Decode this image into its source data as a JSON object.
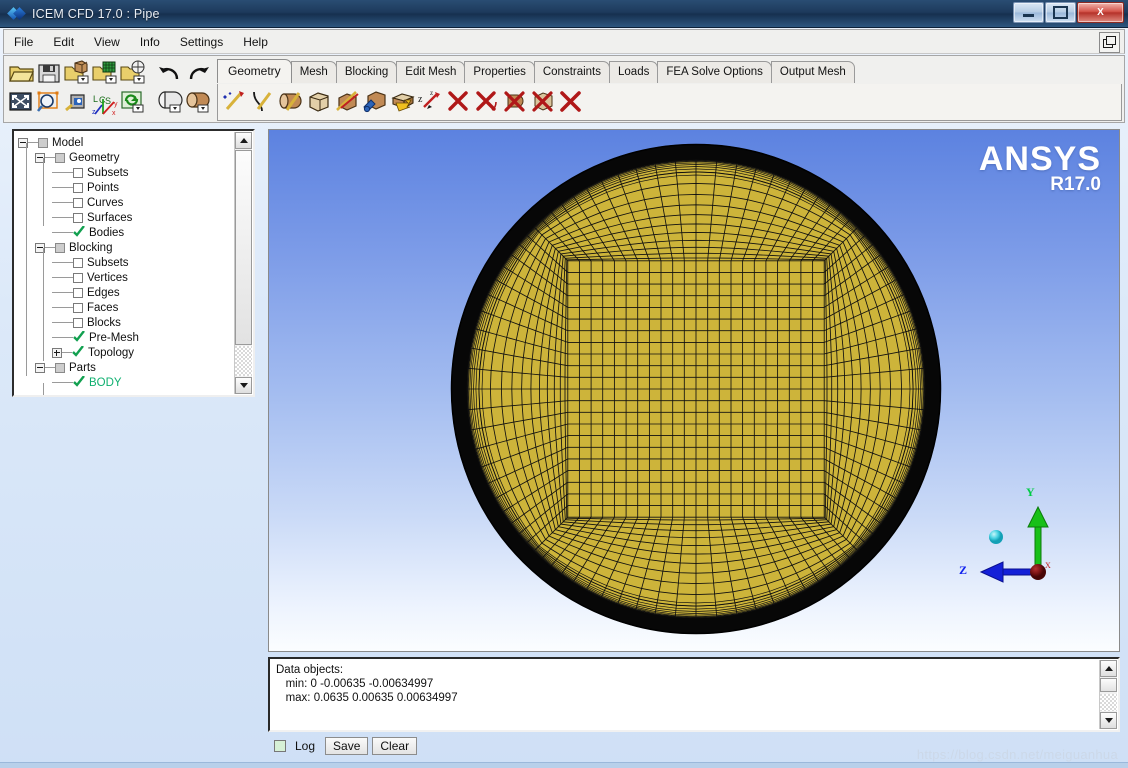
{
  "window": {
    "title": "ICEM CFD 17.0 : Pipe",
    "app_icon": "ansys-diamond-icon",
    "minimize_label": "",
    "restore_label": "",
    "close_label": "X"
  },
  "menubar": {
    "items": [
      "File",
      "Edit",
      "View",
      "Info",
      "Settings",
      "Help"
    ],
    "cascade_icon": "restore-window-icon"
  },
  "toolbar": {
    "main_icons_row1": [
      {
        "name": "open-file-icon",
        "glyph": "folder"
      },
      {
        "name": "save-file-icon",
        "glyph": "floppy"
      },
      {
        "name": "open-geometry-icon",
        "glyph": "folder-box"
      },
      {
        "name": "open-mesh-icon",
        "glyph": "folder-mesh"
      },
      {
        "name": "open-blocking-icon",
        "glyph": "folder-block"
      },
      {
        "name": "undo-icon",
        "glyph": "undo"
      },
      {
        "name": "redo-icon",
        "glyph": "redo"
      }
    ],
    "main_icons_row2": [
      {
        "name": "fit-window-icon",
        "glyph": "fit"
      },
      {
        "name": "zoom-box-icon",
        "glyph": "magnifier"
      },
      {
        "name": "measure-icon",
        "glyph": "measure"
      },
      {
        "name": "local-coord-system-icon",
        "glyph": "lcs"
      },
      {
        "name": "refresh-icon",
        "glyph": "refresh"
      },
      {
        "name": "view-sections-icon",
        "glyph": "cut-cylinder"
      },
      {
        "name": "view-solid-icon",
        "glyph": "solid-cylinder"
      }
    ],
    "function_icons": [
      {
        "name": "create-point-icon"
      },
      {
        "name": "create-curve-icon"
      },
      {
        "name": "create-surface-icon"
      },
      {
        "name": "create-body-icon"
      },
      {
        "name": "repair-geometry-icon"
      },
      {
        "name": "transform-geometry-icon"
      },
      {
        "name": "restore-dormant-icon"
      },
      {
        "name": "create-midsurface-icon"
      },
      {
        "name": "delete-point-icon"
      },
      {
        "name": "delete-curve-icon"
      },
      {
        "name": "delete-surface-icon"
      },
      {
        "name": "delete-body-icon"
      },
      {
        "name": "delete-any-icon"
      }
    ]
  },
  "tabs": [
    {
      "label": "Geometry",
      "active": true
    },
    {
      "label": "Mesh",
      "active": false
    },
    {
      "label": "Blocking",
      "active": false
    },
    {
      "label": "Edit Mesh",
      "active": false
    },
    {
      "label": "Properties",
      "active": false
    },
    {
      "label": "Constraints",
      "active": false
    },
    {
      "label": "Loads",
      "active": false
    },
    {
      "label": "FEA Solve Options",
      "active": false
    },
    {
      "label": "Output Mesh",
      "active": false
    }
  ],
  "tree": {
    "nodes": [
      {
        "label": "Model",
        "depth": 0,
        "toggle": "minus",
        "state": "partial",
        "selected": false
      },
      {
        "label": "Geometry",
        "depth": 1,
        "toggle": "minus",
        "state": "partial",
        "selected": false
      },
      {
        "label": "Subsets",
        "depth": 2,
        "toggle": "none",
        "state": "unchecked",
        "selected": false
      },
      {
        "label": "Points",
        "depth": 2,
        "toggle": "none",
        "state": "unchecked",
        "selected": false
      },
      {
        "label": "Curves",
        "depth": 2,
        "toggle": "none",
        "state": "unchecked",
        "selected": false
      },
      {
        "label": "Surfaces",
        "depth": 2,
        "toggle": "none",
        "state": "unchecked",
        "selected": false
      },
      {
        "label": "Bodies",
        "depth": 2,
        "toggle": "none",
        "state": "checked",
        "selected": false
      },
      {
        "label": "Blocking",
        "depth": 1,
        "toggle": "minus",
        "state": "partial",
        "selected": false
      },
      {
        "label": "Subsets",
        "depth": 2,
        "toggle": "none",
        "state": "unchecked",
        "selected": false
      },
      {
        "label": "Vertices",
        "depth": 2,
        "toggle": "none",
        "state": "unchecked",
        "selected": false
      },
      {
        "label": "Edges",
        "depth": 2,
        "toggle": "none",
        "state": "unchecked",
        "selected": false
      },
      {
        "label": "Faces",
        "depth": 2,
        "toggle": "none",
        "state": "unchecked",
        "selected": false
      },
      {
        "label": "Blocks",
        "depth": 2,
        "toggle": "none",
        "state": "unchecked",
        "selected": false
      },
      {
        "label": "Pre-Mesh",
        "depth": 2,
        "toggle": "none",
        "state": "checked",
        "selected": false
      },
      {
        "label": "Topology",
        "depth": 2,
        "toggle": "plus",
        "state": "checked",
        "selected": false
      },
      {
        "label": "Parts",
        "depth": 1,
        "toggle": "minus",
        "state": "partial",
        "selected": false
      },
      {
        "label": "BODY",
        "depth": 2,
        "toggle": "none",
        "state": "checked",
        "selected": true
      }
    ],
    "scrollbar": {
      "up_icon": "scroll-up-arrow-icon",
      "down_icon": "scroll-down-arrow-icon"
    }
  },
  "viewport": {
    "logo_primary": "ANSYS",
    "logo_release": "R17.0",
    "background_top_color": "#5c82e0",
    "background_bottom_color": "#fbfdff",
    "mesh_fill_color": "#cdb43a",
    "mesh_line_color": "#101010",
    "triad": {
      "y_label": "Y",
      "z_label": "Z",
      "y_axis_color": "#00cc44",
      "z_axis_color": "#1122ee",
      "origin_color": "#7a1010",
      "marker_color": "#55dde8"
    }
  },
  "message_panel": {
    "lines": [
      "Data objects:",
      "   min: 0 -0.00635 -0.00634997",
      "   max: 0.0635 0.00635 0.00634997"
    ]
  },
  "buttons": {
    "log_checkbox_label": "Log",
    "save_label": "Save",
    "clear_label": "Clear"
  },
  "watermark": "https://blog.csdn.net/meiguanhua"
}
